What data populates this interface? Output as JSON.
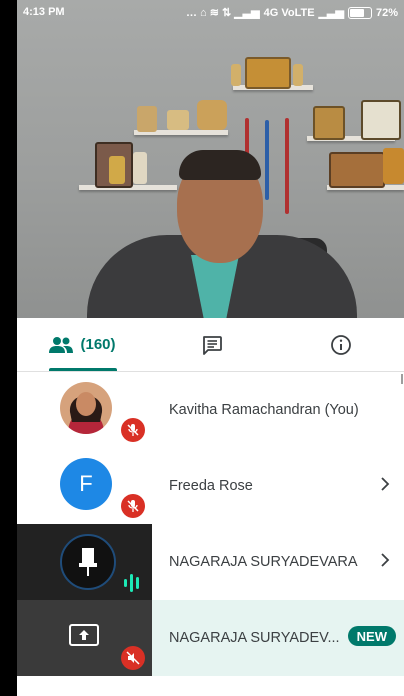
{
  "status_bar": {
    "time": "4:13 PM",
    "network": "4G VoLTE",
    "battery": "72%"
  },
  "tabs": {
    "people_label": "(160)",
    "people_icon": "people-icon",
    "chat_icon": "chat-icon",
    "info_icon": "info-icon"
  },
  "participants": [
    {
      "name": "Kavitha Ramachandran (You)",
      "muted": true,
      "avatar": "photo"
    },
    {
      "name": "Freeda Rose",
      "muted": true,
      "avatar_letter": "F",
      "avatar_color": "#1e88e5"
    },
    {
      "name": "NAGARAJA SURYADEVARA",
      "speaking": true
    },
    {
      "name": "NAGARAJA SURYADEV...",
      "badge": "NEW",
      "presenting": true,
      "muted": true
    }
  ],
  "colors": {
    "accent": "#00796b",
    "muted_red": "#d93025",
    "highlight_row": "#e6f4f1"
  }
}
